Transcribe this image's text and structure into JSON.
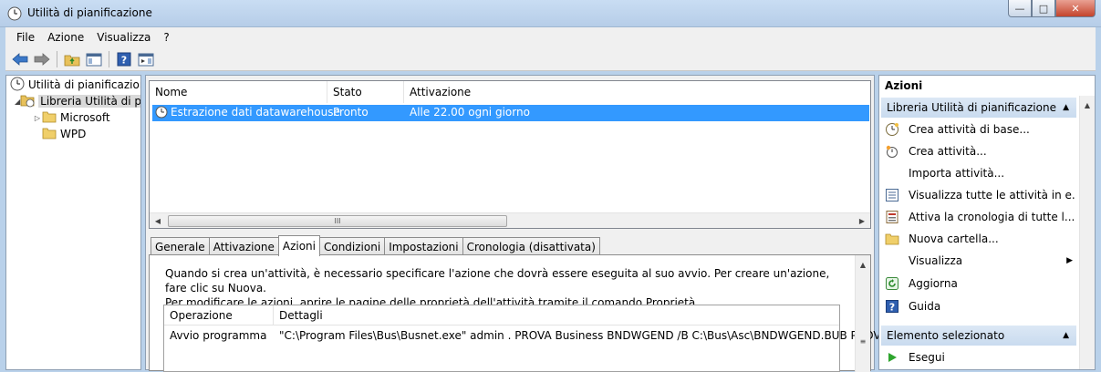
{
  "window": {
    "title": "Utilità di pianificazione"
  },
  "menu": [
    "File",
    "Azione",
    "Visualizza",
    "?"
  ],
  "tree": {
    "root": "Utilità di pianificazione",
    "library": "Libreria Utilità di pi",
    "children": [
      "Microsoft",
      "WPD"
    ]
  },
  "tasklist": {
    "columns": [
      "Nome",
      "Stato",
      "Attivazione"
    ],
    "rows": [
      {
        "name": "Estrazione dati datawarehouse",
        "status": "Pronto",
        "trigger": "Alle 22.00 ogni giorno"
      }
    ],
    "scroll_thumb": "III"
  },
  "tabs": [
    "Generale",
    "Attivazione",
    "Azioni",
    "Condizioni",
    "Impostazioni",
    "Cronologia (disattivata)"
  ],
  "actions_tab": {
    "description_line1": "Quando si crea un'attività, è necessario specificare l'azione che dovrà essere eseguita al suo avvio. Per creare un'azione, fare clic su Nuova.",
    "description_line2": "Per modificare le azioni, aprire le pagine delle proprietà dell'attività tramite il comando Proprietà.",
    "columns": [
      "Operazione",
      "Dettagli"
    ],
    "rows": [
      {
        "operation": "Avvio programma",
        "details": "\"C:\\Program Files\\Bus\\Busnet.exe\" admin . PROVA Business  BNDWGEND /B C:\\Bus\\Asc\\BNDWGEND.BUB PROVA"
      }
    ]
  },
  "actions_pane": {
    "title": "Azioni",
    "section1": "Libreria Utilità di pianificazione",
    "items": [
      {
        "label": "Crea attività di base...",
        "icon": "clock-wand-icon"
      },
      {
        "label": "Crea attività...",
        "icon": "task-icon"
      },
      {
        "label": "Importa attività...",
        "icon": ""
      },
      {
        "label": "Visualizza tutte le attività in e...",
        "icon": "list-icon"
      },
      {
        "label": "Attiva la cronologia di tutte l...",
        "icon": "history-icon"
      },
      {
        "label": "Nuova cartella...",
        "icon": "folder-icon"
      },
      {
        "label": "Visualizza",
        "icon": ""
      },
      {
        "label": "Aggiorna",
        "icon": "refresh-icon"
      },
      {
        "label": "Guida",
        "icon": "help-icon"
      }
    ],
    "section2": "Elemento selezionato",
    "items2": [
      {
        "label": "Esegui",
        "icon": "run-icon"
      }
    ]
  },
  "colors": {
    "selection": "#3399ff",
    "section_header": "#d0e0f2"
  }
}
